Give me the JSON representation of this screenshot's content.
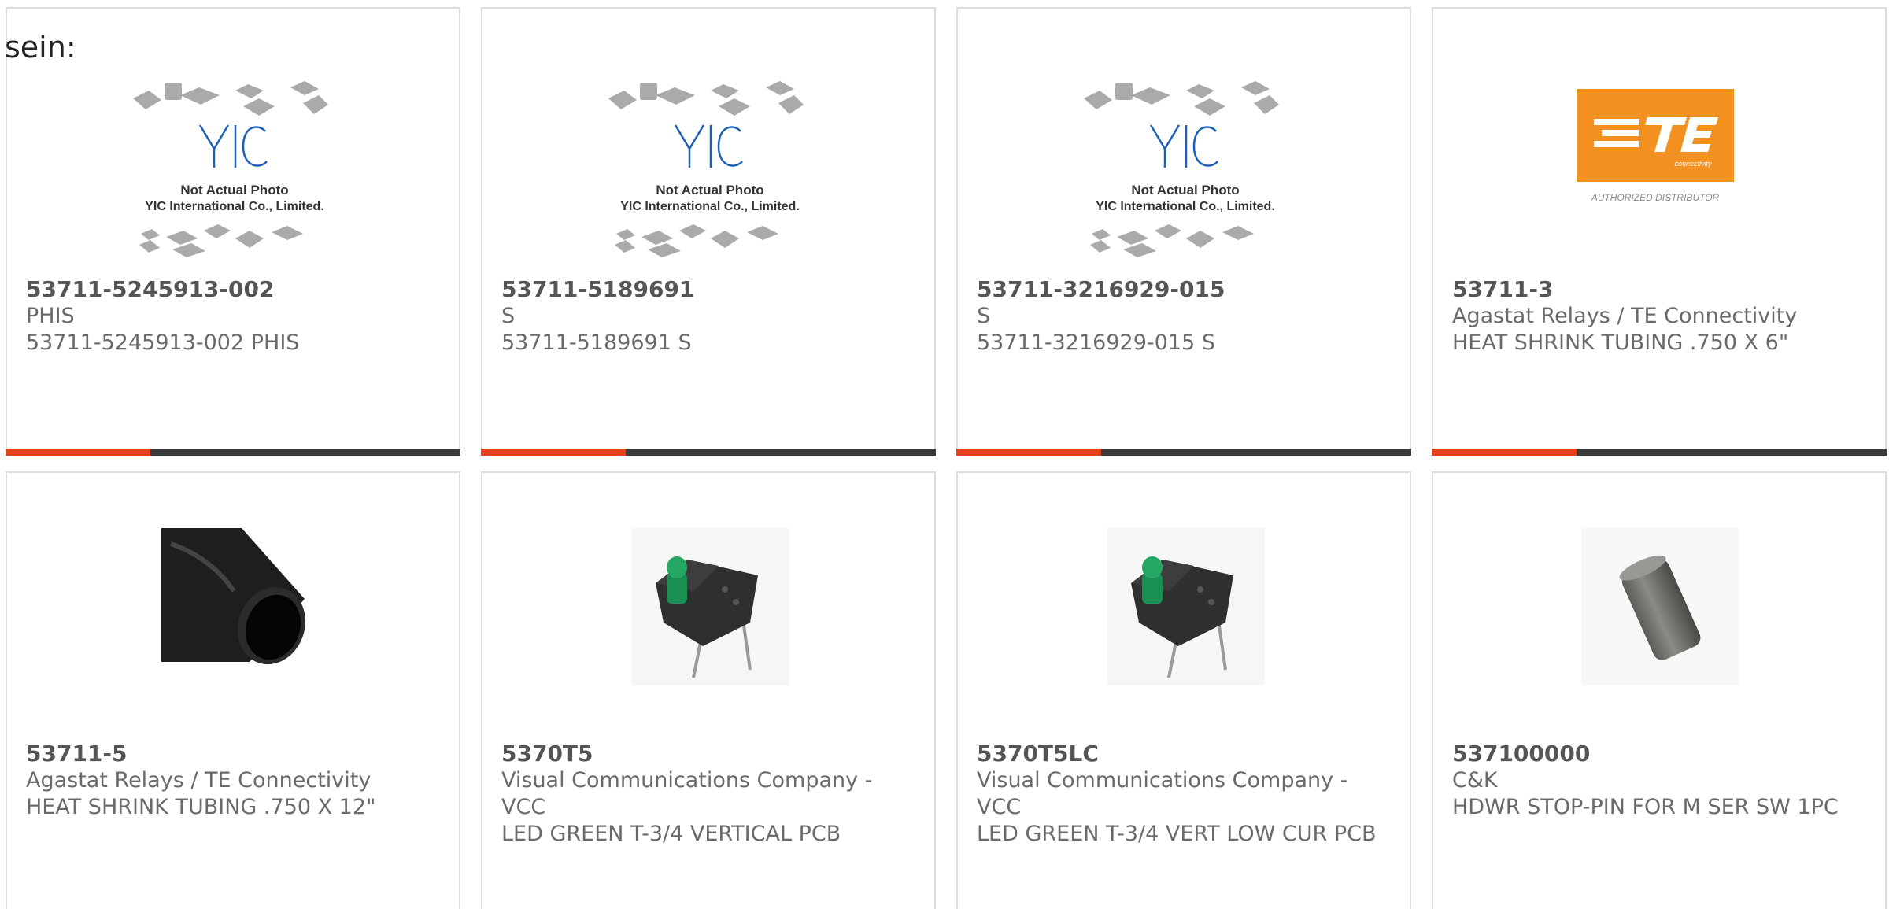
{
  "page": {
    "fragment_text": "sein:"
  },
  "colors": {
    "accent": "#e8401c",
    "bar": "#3a3a3a",
    "border": "#dcdcdc",
    "text": "#6a6a6a",
    "te_orange": "#f39120"
  },
  "products": [
    {
      "part_number": "53711-5245913-002",
      "manufacturer": "PHIS",
      "description": "53711-5245913-002 PHIS",
      "image": "yic-not-actual-photo",
      "image_text": [
        "Not Actual Photo",
        "YIC International Co., Limited."
      ]
    },
    {
      "part_number": "53711-5189691",
      "manufacturer": "S",
      "description": "53711-5189691 S",
      "image": "yic-not-actual-photo",
      "image_text": [
        "Not Actual Photo",
        "YIC International Co., Limited."
      ]
    },
    {
      "part_number": "53711-3216929-015",
      "manufacturer": "S",
      "description": "53711-3216929-015 S",
      "image": "yic-not-actual-photo",
      "image_text": [
        "Not Actual Photo",
        "YIC International Co., Limited."
      ]
    },
    {
      "part_number": "53711-3",
      "manufacturer": "Agastat Relays / TE Connectivity",
      "description": "HEAT SHRINK TUBING .750 X 6\"",
      "image": "te-connectivity-logo",
      "image_text": [
        "AUTHORIZED DISTRIBUTOR"
      ]
    },
    {
      "part_number": "53711-5",
      "manufacturer": "Agastat Relays / TE Connectivity",
      "description": "HEAT SHRINK TUBING .750 X 12\"",
      "image": "black-heat-shrink-tube"
    },
    {
      "part_number": "5370T5",
      "manufacturer": "Visual Communications Company - VCC",
      "description": "LED GREEN T-3/4 VERTICAL PCB",
      "image": "green-led-pcb"
    },
    {
      "part_number": "5370T5LC",
      "manufacturer": "Visual Communications Company - VCC",
      "description": "LED GREEN T-3/4 VERT LOW CUR PCB",
      "image": "green-led-pcb"
    },
    {
      "part_number": "537100000",
      "manufacturer": "C&K",
      "description": "HDWR STOP-PIN FOR M SER SW 1PC",
      "image": "metal-stop-pin"
    }
  ]
}
